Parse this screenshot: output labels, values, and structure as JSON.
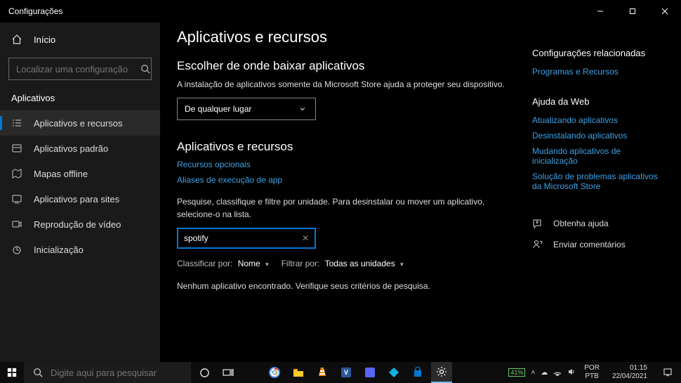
{
  "window": {
    "title": "Configurações"
  },
  "sidebar": {
    "home": "Início",
    "search_placeholder": "Localizar uma configuração",
    "section": "Aplicativos",
    "items": [
      {
        "label": "Aplicativos e recursos"
      },
      {
        "label": "Aplicativos padrão"
      },
      {
        "label": "Mapas offline"
      },
      {
        "label": "Aplicativos para sites"
      },
      {
        "label": "Reprodução de vídeo"
      },
      {
        "label": "Inicialização"
      }
    ]
  },
  "content": {
    "h1": "Aplicativos e recursos",
    "download_heading": "Escolher de onde baixar aplicativos",
    "download_desc": "A instalação de aplicativos somente da Microsoft Store ajuda a proteger seu dispositivo.",
    "download_value": "De qualquer lugar",
    "apps_heading": "Aplicativos e recursos",
    "link_optional": "Recursos opcionais",
    "link_aliases": "Aliases de execução de app",
    "search_desc": "Pesquise, classifique e filtre por unidade. Para desinstalar ou mover um aplicativo, selecione-o na lista.",
    "search_value": "spotify",
    "sort_label": "Classificar por:",
    "sort_value": "Nome",
    "filter_label": "Filtrar por:",
    "filter_value": "Todas as unidades",
    "empty": "Nenhum aplicativo encontrado. Verifique seus critérios de pesquisa."
  },
  "right": {
    "related_heading": "Configurações relacionadas",
    "related_link": "Programas e Recursos",
    "web_heading": "Ajuda da Web",
    "web_links": [
      "Atualizando aplicativos",
      "Desinstalando aplicativos",
      "Mudando aplicativos de inicialização",
      "Solução de problemas aplicativos da Microsoft Store"
    ],
    "help": "Obtenha ajuda",
    "feedback": "Enviar comentários"
  },
  "taskbar": {
    "search_placeholder": "Digite aqui para pesquisar",
    "battery": "41%",
    "lang_top": "POR",
    "lang_bot": "PTB",
    "time": "01:15",
    "date": "22/04/2021"
  }
}
